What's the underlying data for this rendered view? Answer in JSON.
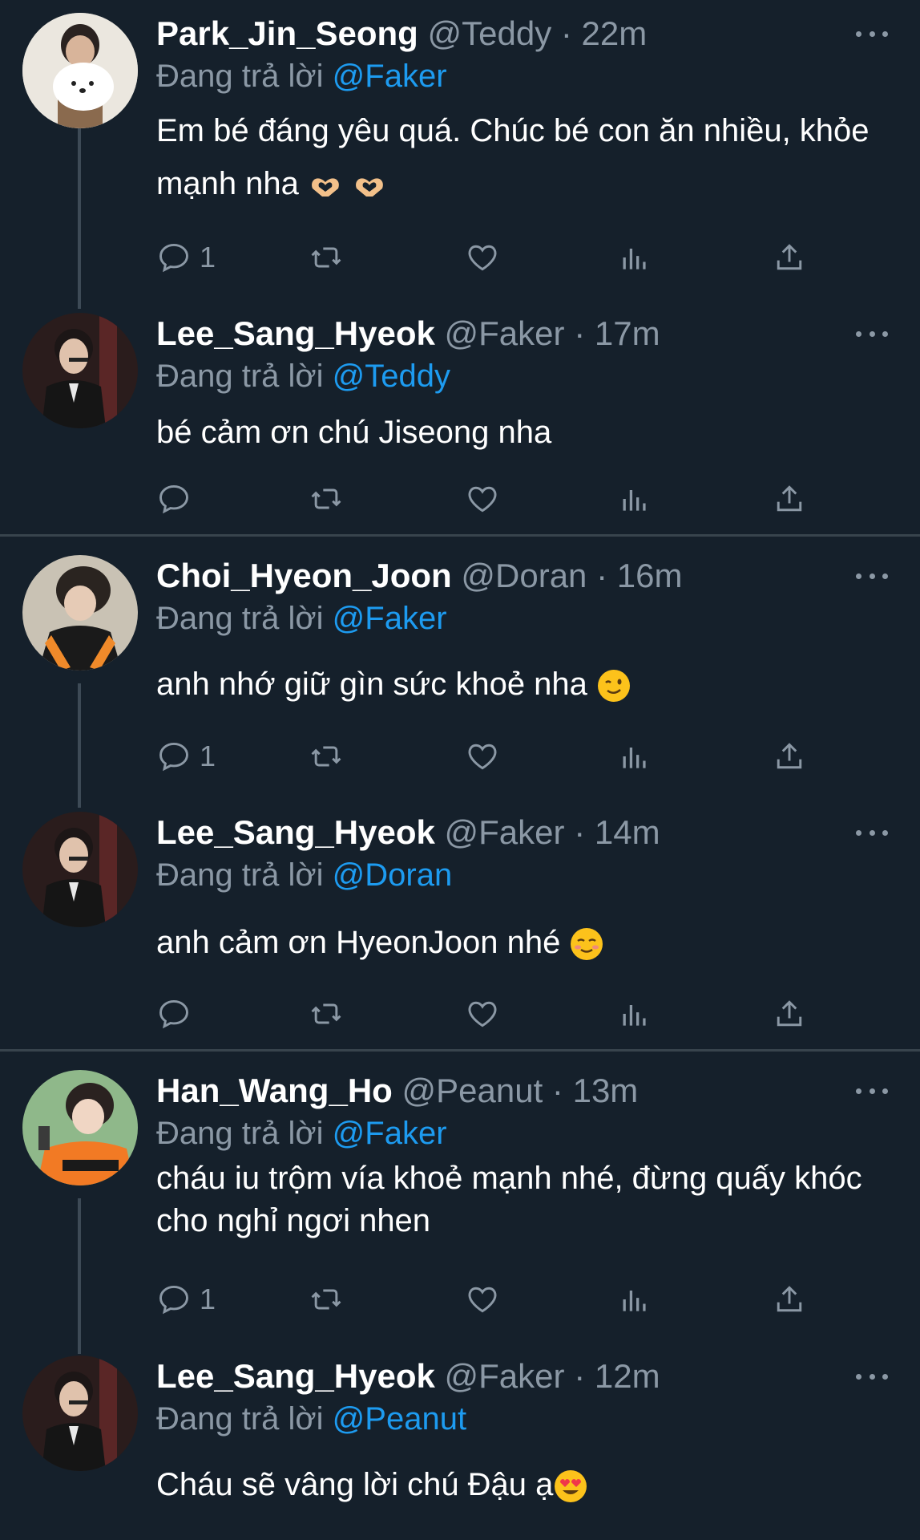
{
  "reply_prefix": "Đang trả lời",
  "colors": {
    "background": "#15202b",
    "accent": "#1d9bf0",
    "muted": "#8b98a5",
    "divider": "#38444d"
  },
  "tweets": [
    {
      "name": "Park_Jin_Seong",
      "handle": "@Teddy",
      "time": "22m",
      "reply_to": "@Faker",
      "text": " Em bé đáng yêu quá. Chúc bé con ăn nhiều, khỏe mạnh nha",
      "emoji": [
        "heart-hands-icon",
        "heart-hands-icon"
      ],
      "reply_count": "1"
    },
    {
      "name": "Lee_Sang_Hyeok",
      "handle": "@Faker",
      "time": "17m",
      "reply_to": "@Teddy",
      "text": "bé cảm ơn chú Jiseong nha",
      "emoji": [],
      "reply_count": ""
    },
    {
      "name": "Choi_Hyeon_Joon",
      "handle": "@Doran",
      "time": "16m",
      "reply_to": "@Faker",
      "text": "anh nhớ giữ gìn sức khoẻ nha ",
      "emoji": [
        "wink-face-icon"
      ],
      "reply_count": "1"
    },
    {
      "name": "Lee_Sang_Hyeok",
      "handle": "@Faker",
      "time": "14m",
      "reply_to": "@Doran",
      "text": "anh cảm ơn HyeonJoon nhé ",
      "emoji": [
        "smiling-blush-face-icon"
      ],
      "reply_count": ""
    },
    {
      "name": "Han_Wang_Ho",
      "handle": "@Peanut",
      "time": "13m",
      "reply_to": "@Faker",
      "text": "cháu iu trộm vía khoẻ mạnh nhé, đừng quấy khóc cho nghỉ ngơi nhen",
      "emoji": [],
      "reply_count": "1"
    },
    {
      "name": "Lee_Sang_Hyeok",
      "handle": "@Faker",
      "time": "12m",
      "reply_to": "@Peanut",
      "text": "Cháu sẽ vâng lời chú Đậu ạ",
      "emoji": [
        "heart-eyes-face-icon"
      ],
      "reply_count": ""
    }
  ]
}
